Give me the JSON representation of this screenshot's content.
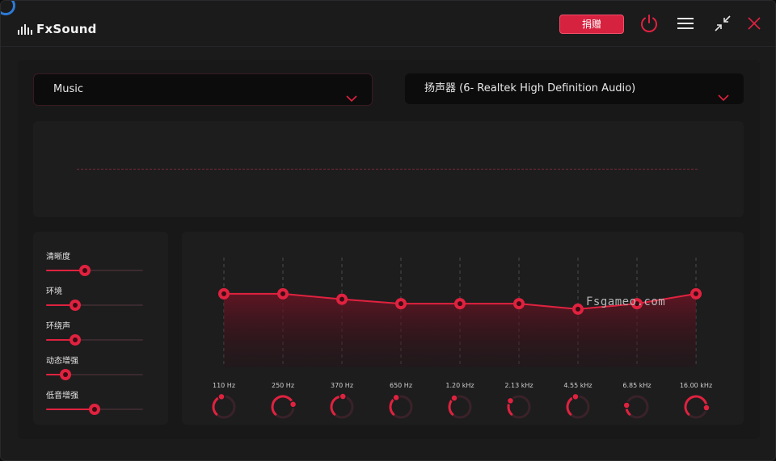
{
  "app": {
    "name": "FxSound"
  },
  "header": {
    "donate_label": "捐赠"
  },
  "presets": {
    "preset_value": "Music",
    "output_value": "扬声器 (6- Realtek High Definition Audio)"
  },
  "effects": [
    {
      "label": "清晰度",
      "value": 0.4
    },
    {
      "label": "环境",
      "value": 0.3
    },
    {
      "label": "环绕声",
      "value": 0.3
    },
    {
      "label": "动态增强",
      "value": 0.2
    },
    {
      "label": "低音增强",
      "value": 0.5
    }
  ],
  "eq": {
    "bands": [
      {
        "label": "110 Hz",
        "level": 0.67,
        "knob": 0.45
      },
      {
        "label": "250 Hz",
        "level": 0.67,
        "knob": 0.78
      },
      {
        "label": "370 Hz",
        "level": 0.62,
        "knob": 0.52
      },
      {
        "label": "650 Hz",
        "level": 0.58,
        "knob": 0.4
      },
      {
        "label": "1.20 kHz",
        "level": 0.58,
        "knob": 0.38
      },
      {
        "label": "2.13 kHz",
        "level": 0.58,
        "knob": 0.3
      },
      {
        "label": "4.55 kHz",
        "level": 0.53,
        "knob": 0.45
      },
      {
        "label": "6.85 kHz",
        "level": 0.58,
        "knob": 0.2
      },
      {
        "label": "16.00 kHz",
        "level": 0.67,
        "knob": 0.85
      }
    ]
  },
  "watermark": "Fsgameo.com",
  "colors": {
    "accent": "#e0223f",
    "background": "#1b1b1c",
    "panel": "#1d1d1e"
  }
}
